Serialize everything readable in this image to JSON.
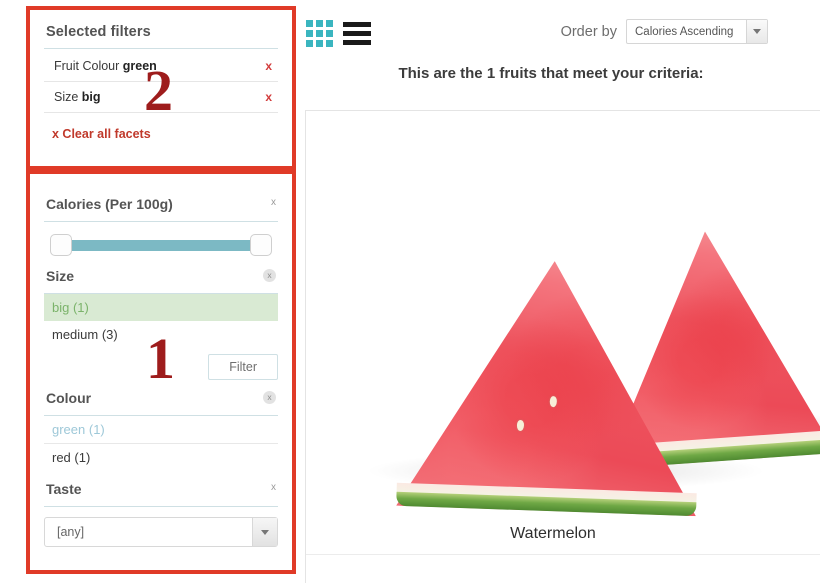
{
  "annotations": {
    "num_top": "2",
    "num_bottom": "1",
    "box_color": "#e03a27",
    "num_color": "#9e1c1c"
  },
  "selected_filters": {
    "title": "Selected filters",
    "rows": [
      {
        "prefix": "Fruit Colour ",
        "value": "green",
        "remove": "x"
      },
      {
        "prefix": "Size ",
        "value": "big",
        "remove": "x"
      }
    ],
    "clear_all": "x Clear all facets"
  },
  "facets": {
    "calories": {
      "title": "Calories (Per 100g)",
      "close": "x",
      "slider": {
        "track_color": "#7cb9c4",
        "min_handle": "left",
        "max_handle": "right"
      }
    },
    "size": {
      "title": "Size",
      "close": "x",
      "options": [
        {
          "label": "big (1)",
          "state": "selected"
        },
        {
          "label": "medium (3)",
          "state": "normal"
        }
      ],
      "filter_button": "Filter"
    },
    "colour": {
      "title": "Colour",
      "close": "x",
      "options": [
        {
          "label": "green (1)",
          "state": "link"
        },
        {
          "label": "red (1)",
          "state": "normal"
        }
      ]
    },
    "taste": {
      "title": "Taste",
      "close": "x",
      "selected_value": "[any]"
    }
  },
  "toolbar": {
    "grid_view_icon": "grid-view-icon",
    "list_view_icon": "list-view-icon",
    "grid_icon_color": "#3ab5bf",
    "list_icon_color": "#1a1a1a"
  },
  "order_by": {
    "label": "Order by",
    "selected_value": "Calories Ascending"
  },
  "results": {
    "note": "This are the 1 fruits that meet your criteria:",
    "items": [
      {
        "name": "Watermelon",
        "image": "watermelon-photo"
      }
    ]
  }
}
